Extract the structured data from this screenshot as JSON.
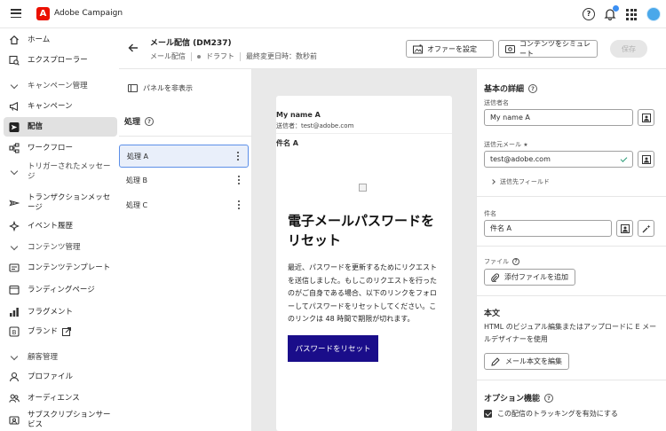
{
  "app": {
    "name": "Adobe Campaign",
    "logo_letter": "A"
  },
  "sidebar": {
    "items": [
      {
        "label": "ホーム",
        "icon": "home-icon"
      },
      {
        "label": "エクスプローラー",
        "icon": "explorer-icon"
      },
      {
        "label": "キャンペーン管理",
        "icon": "chevron-down-icon",
        "section": true
      },
      {
        "label": "キャンペーン",
        "icon": "campaign-icon"
      },
      {
        "label": "配信",
        "icon": "delivery-icon",
        "active": true
      },
      {
        "label": "ワークフロー",
        "icon": "workflow-icon"
      },
      {
        "label": "トリガーされたメッセージ",
        "icon": "chevron-down-icon",
        "section": true
      },
      {
        "label": "トランザクションメッセージ",
        "icon": "transaction-icon"
      },
      {
        "label": "イベント履歴",
        "icon": "event-history-icon"
      },
      {
        "label": "コンテンツ管理",
        "icon": "chevron-down-icon",
        "section": true
      },
      {
        "label": "コンテンツテンプレート",
        "icon": "content-template-icon"
      },
      {
        "label": "ランディングページ",
        "icon": "landing-page-icon"
      },
      {
        "label": "フラグメント",
        "icon": "fragment-icon"
      },
      {
        "label": "ブランド",
        "icon": "brand-icon"
      },
      {
        "label": "顧客管理",
        "icon": "chevron-down-icon",
        "section": true
      },
      {
        "label": "プロファイル",
        "icon": "profile-icon"
      },
      {
        "label": "オーディエンス",
        "icon": "audience-icon"
      },
      {
        "label": "サブスクリプションサービス",
        "icon": "subscription-icon"
      }
    ]
  },
  "header": {
    "title": "メール配信 (DM237)",
    "type": "メール配信",
    "status": "ドラフト",
    "last_modified": "最終変更日時：数秒前",
    "offer_button": "オファーを設定",
    "simulate_button": "コンテンツをシミュレート",
    "save_button": "保存"
  },
  "treatments": {
    "hide_panel": "パネルを非表示",
    "title": "処理",
    "items": [
      "処理 A",
      "処理 B",
      "処理 C"
    ]
  },
  "preview": {
    "sender_name": "My name A",
    "sender_line": "送信者：test@adobe.com",
    "subject": "件名 A",
    "heading": "電子メールパスワードをリセット",
    "paragraph": "最近、パスワードを更新するためにリクエストを送信しました。もしこのリクエストを行ったのがご自身である場合、以下のリンクをフォローしてパスワードをリセットしてください。このリンクは 48 時間で期限が切れます。",
    "button": "パスワードをリセット",
    "button_color": "#1a0d8a"
  },
  "details": {
    "title": "基本の詳細",
    "sender_name_label": "送信者名",
    "sender_name_value": "My name A",
    "sender_email_label": "送信元メール",
    "required_mark": "★",
    "sender_email_value": "test@adobe.com",
    "advanced_label": "送信先フィールド",
    "subject_label": "件名",
    "subject_value": "件名 A",
    "file_label": "ファイル",
    "attach_button": "添付ファイルを追加",
    "body_title": "本文",
    "body_text": "HTML のビジュアル編集またはアップロードに E メールデザイナーを使用",
    "edit_body_button": "メール本文を編集",
    "options_title": "オプション機能",
    "tracking_label": "この配信のトラッキングを有効にする"
  }
}
